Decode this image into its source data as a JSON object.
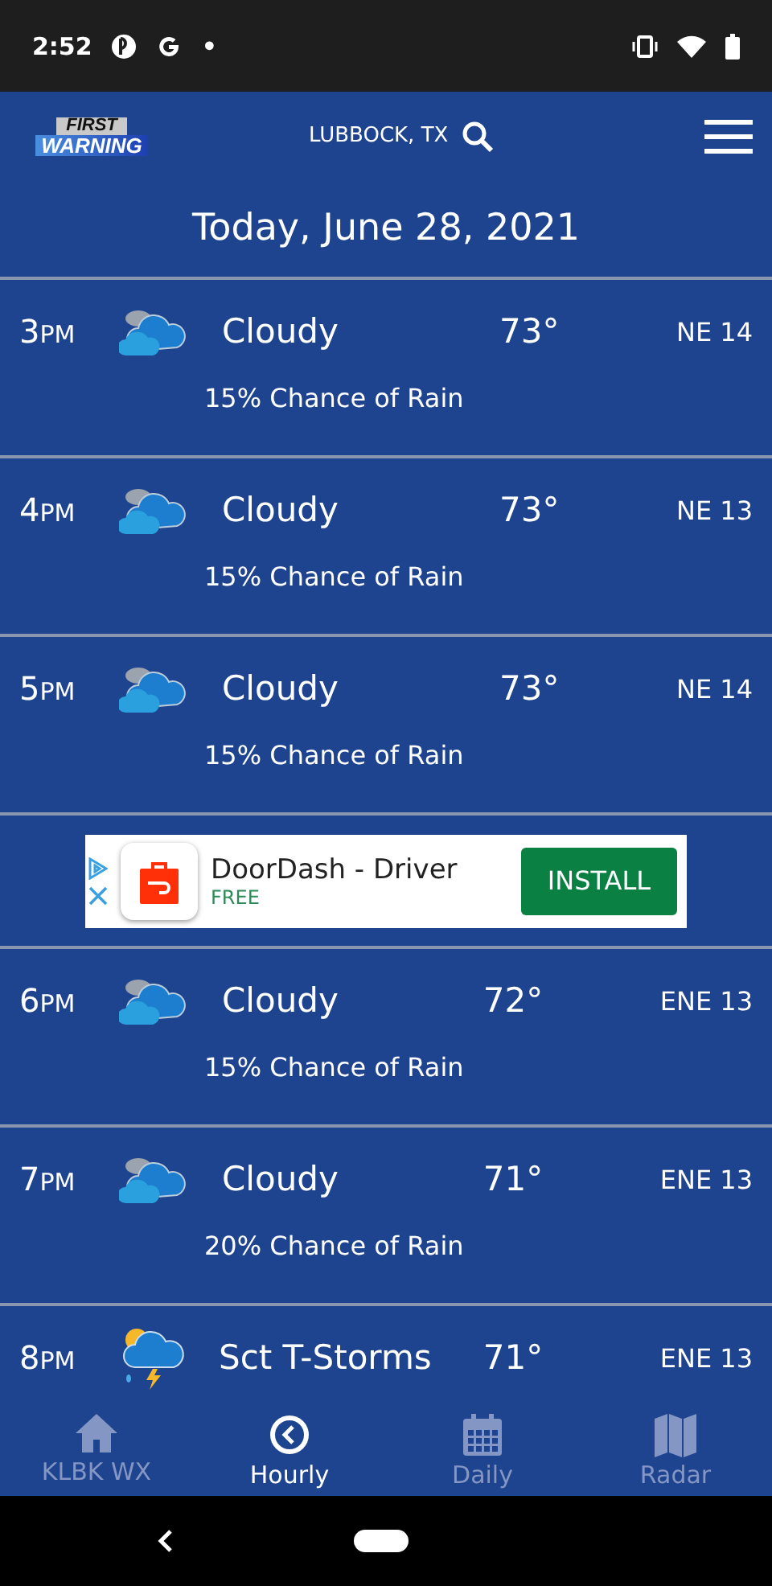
{
  "status_bar": {
    "time": "2:52",
    "dot": "•"
  },
  "header": {
    "logo_top": "FIRST",
    "logo_bottom": "WARNING",
    "location": "LUBBOCK, TX"
  },
  "date": "Today, June 28, 2021",
  "rows": [
    {
      "kind": "cloudy",
      "hour": "3",
      "period": "PM",
      "condition": "Cloudy",
      "temp": "73°",
      "wind": "NE 14",
      "rain": "15% Chance of Rain"
    },
    {
      "kind": "cloudy",
      "hour": "4",
      "period": "PM",
      "condition": "Cloudy",
      "temp": "73°",
      "wind": "NE 13",
      "rain": "15% Chance of Rain"
    },
    {
      "kind": "cloudy",
      "hour": "5",
      "period": "PM",
      "condition": "Cloudy",
      "temp": "73°",
      "wind": "NE 14",
      "rain": "15% Chance of Rain"
    },
    {
      "kind": "ad",
      "title": "DoorDash - Driver",
      "price": "FREE",
      "button": "INSTALL"
    },
    {
      "kind": "cloudy",
      "hour": "6",
      "period": "PM",
      "condition": "Cloudy",
      "temp": "72°",
      "wind": "ENE 13",
      "rain": "15% Chance of Rain"
    },
    {
      "kind": "cloudy",
      "hour": "7",
      "period": "PM",
      "condition": "Cloudy",
      "temp": "71°",
      "wind": "ENE 13",
      "rain": "20% Chance of Rain"
    },
    {
      "kind": "tstorms",
      "hour": "8",
      "period": "PM",
      "condition": "Sct T-Storms",
      "temp": "71°",
      "wind": "ENE 13"
    }
  ],
  "tabs": [
    {
      "label": "KLBK WX",
      "selected": false
    },
    {
      "label": "Hourly",
      "selected": true
    },
    {
      "label": "Daily",
      "selected": false
    },
    {
      "label": "Radar",
      "selected": false
    }
  ]
}
